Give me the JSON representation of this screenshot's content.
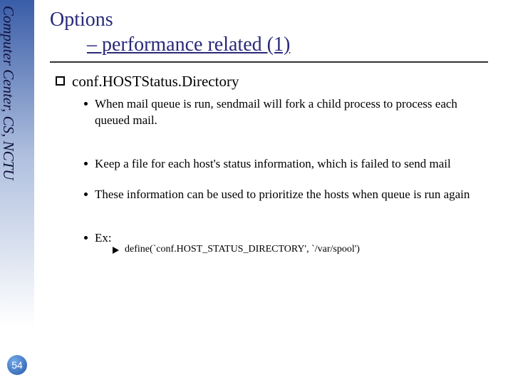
{
  "sidebar": {
    "label": "Computer Center, CS, NCTU"
  },
  "page_number": "54",
  "title": {
    "line1": "Options",
    "line2": "– performance related (1)"
  },
  "main_bullet": "conf.HOSTStatus.Directory",
  "items": {
    "a": "When mail queue is run, sendmail will fork a child process to process each queued mail.",
    "b": "Keep a file for each host's status information, which is failed to send mail",
    "c": "These information can be used to prioritize the hosts when queue is run again",
    "d": "Ex:"
  },
  "example": "define(`conf.HOST_STATUS_DIRECTORY', `/var/spool')"
}
